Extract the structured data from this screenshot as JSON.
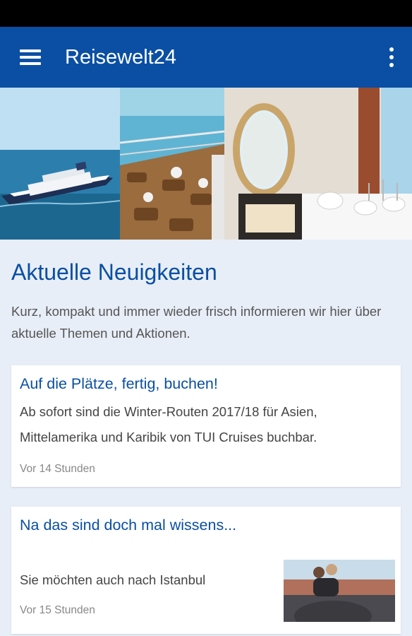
{
  "app": {
    "title": "Reisewelt24"
  },
  "hero": {
    "panels": [
      {
        "name": "cruise-ship-photo"
      },
      {
        "name": "ship-deck-photo"
      },
      {
        "name": "dining-room-photo"
      }
    ]
  },
  "news": {
    "title": "Aktuelle Neuigkeiten",
    "description": "Kurz, kompakt und immer wieder frisch informieren wir hier über aktuelle Themen und Aktionen.",
    "items": [
      {
        "title": "Auf die Plätze, fertig, buchen!",
        "text": "Ab sofort sind die Winter-Routen 2017/18 für Asien, Mittelamerika und Karibik von TUI Cruises buchbar.",
        "time": "Vor 14 Stunden"
      },
      {
        "title": "Na das sind doch mal wissens...",
        "text": "Sie möchten auch nach Istanbul",
        "time": "Vor 15 Stunden"
      }
    ]
  },
  "icons": {
    "menu": "hamburger-menu-icon",
    "overflow": "more-vert-icon"
  },
  "colors": {
    "primary": "#0a4fa3",
    "background": "#e8eef7",
    "statusbar": "#000000"
  }
}
